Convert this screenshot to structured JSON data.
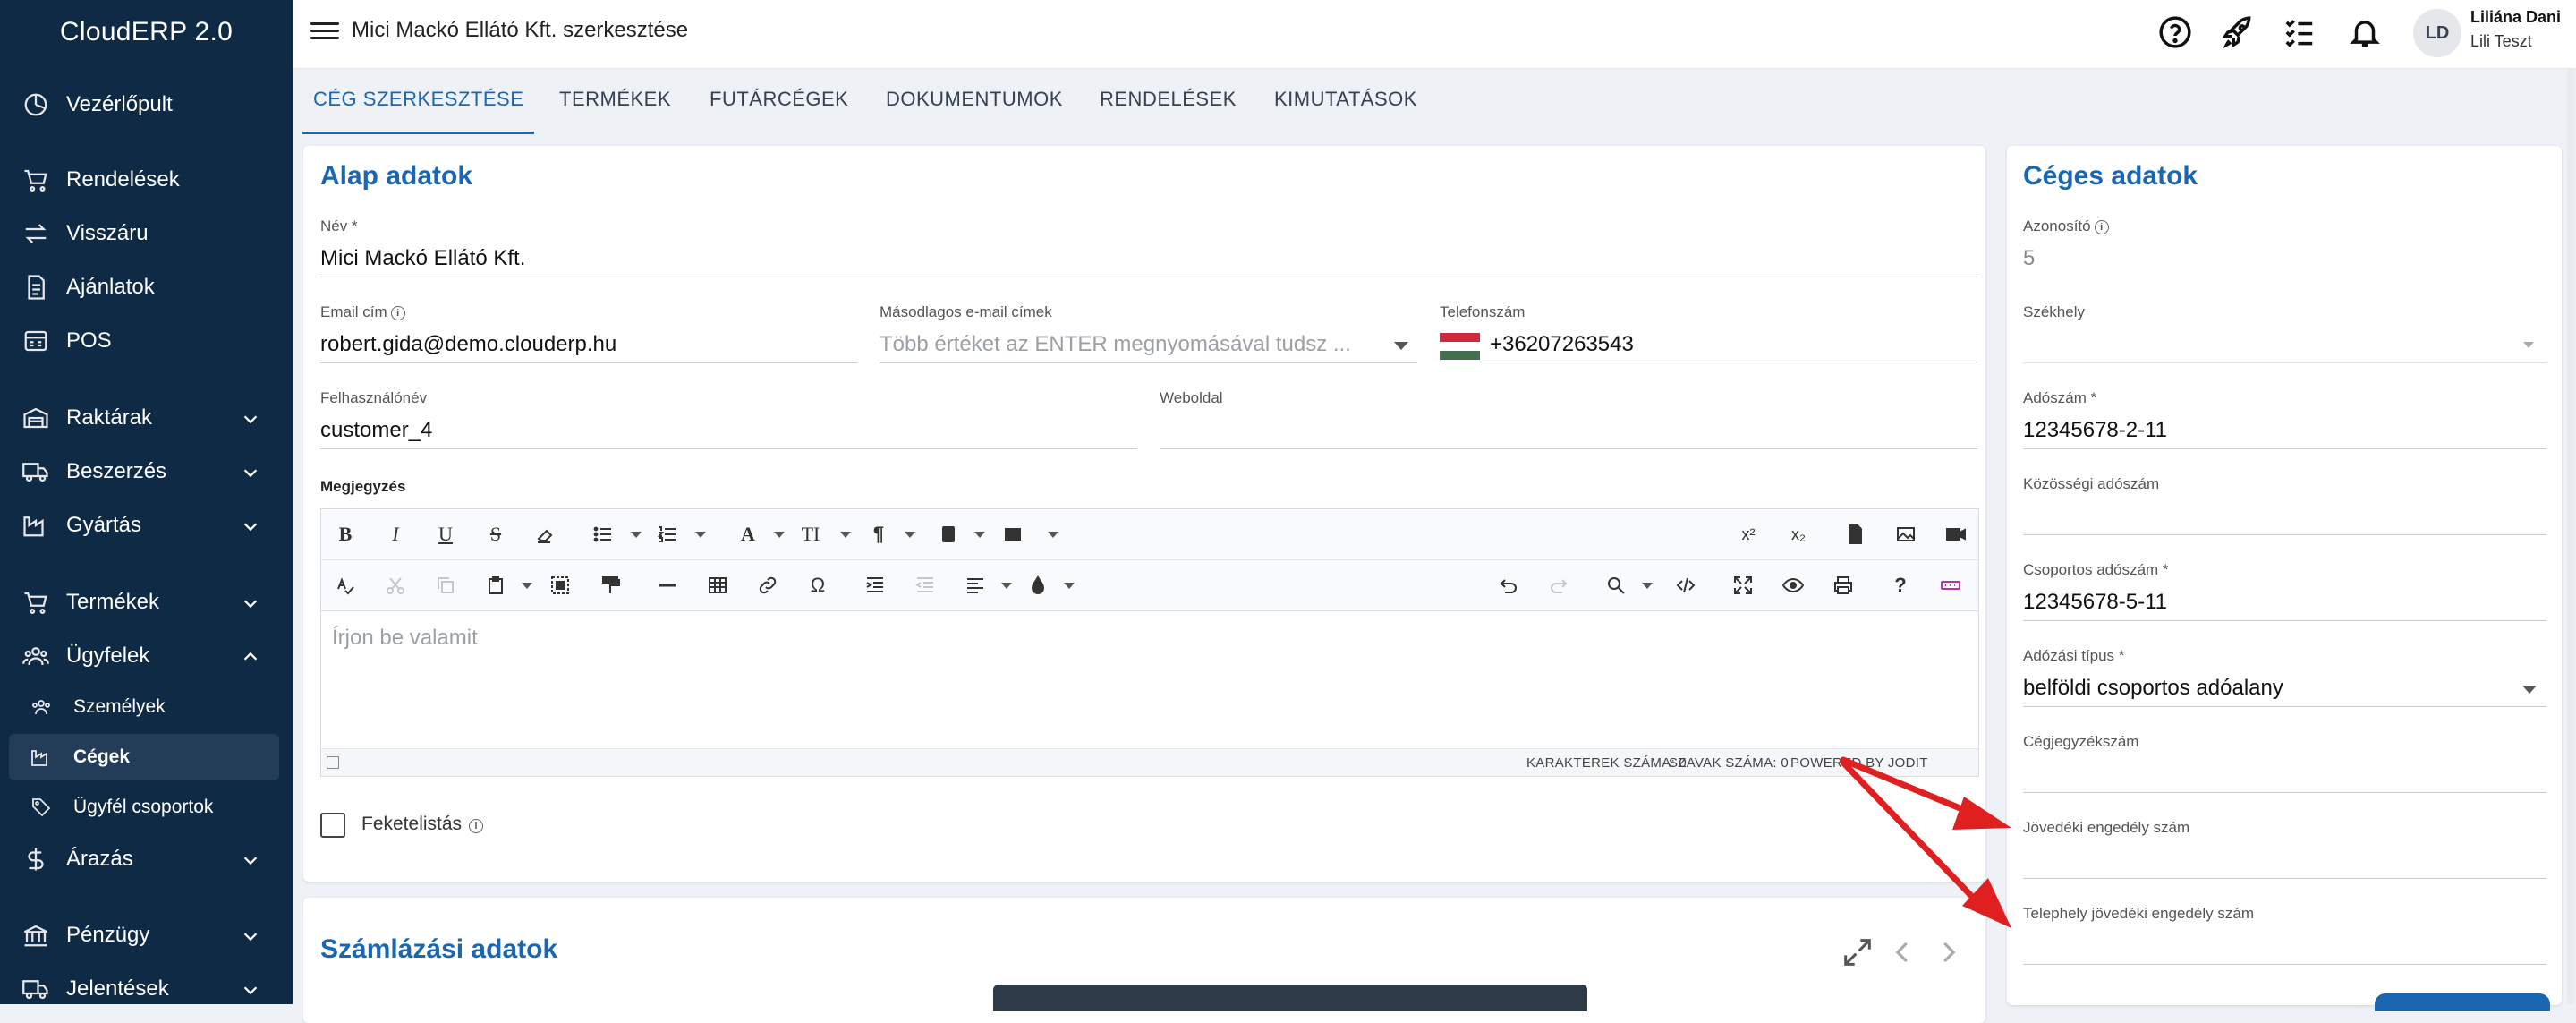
{
  "app": {
    "name": "CloudERP 2.0"
  },
  "sidebar": {
    "items": [
      {
        "label": "Vezérlőpult",
        "icon": "dashboard-gauge-icon"
      },
      {
        "label": "Rendelések",
        "icon": "cart-icon"
      },
      {
        "label": "Visszáru",
        "icon": "swap-arrows-icon"
      },
      {
        "label": "Ajánlatok",
        "icon": "document-icon"
      },
      {
        "label": "POS",
        "icon": "pos-register-icon"
      },
      {
        "label": "Raktárak",
        "icon": "warehouse-icon",
        "expandable": true
      },
      {
        "label": "Beszerzés",
        "icon": "truck-icon",
        "expandable": true
      },
      {
        "label": "Gyártás",
        "icon": "factory-icon",
        "expandable": true
      },
      {
        "label": "Termékek",
        "icon": "cart-icon",
        "expandable": true
      },
      {
        "label": "Ügyfelek",
        "icon": "users-icon",
        "expandable": true,
        "expanded": true
      },
      {
        "label": "Árazás",
        "icon": "dollar-icon",
        "expandable": true
      },
      {
        "label": "Pénzügy",
        "icon": "bank-icon",
        "expandable": true
      },
      {
        "label": "Jelentések",
        "icon": "truck-icon",
        "expandable": true
      }
    ],
    "subitems": [
      {
        "label": "Személyek",
        "icon": "people-icon"
      },
      {
        "label": "Cégek",
        "icon": "factory-icon",
        "active": true
      },
      {
        "label": "Ügyfél csoportok",
        "icon": "tag-icon"
      }
    ]
  },
  "topbar": {
    "title": "Mici Mackó Ellátó Kft. szerkesztése",
    "icons": [
      "help-icon",
      "rocket-icon",
      "checklist-icon",
      "bell-icon"
    ],
    "user": {
      "initials": "LD",
      "name": "Liliána Dani",
      "subtitle": "Lili Teszt"
    }
  },
  "tabs": [
    {
      "label": "CÉG SZERKESZTÉSE",
      "active": true
    },
    {
      "label": "TERMÉKEK"
    },
    {
      "label": "FUTÁRCÉGEK"
    },
    {
      "label": "DOKUMENTUMOK"
    },
    {
      "label": "RENDELÉSEK"
    },
    {
      "label": "KIMUTATÁSOK"
    }
  ],
  "basic": {
    "title": "Alap adatok",
    "name": {
      "label": "Név *",
      "value": "Mici Mackó Ellátó Kft."
    },
    "email": {
      "label": "Email cím",
      "value": "robert.gida@demo.clouderp.hu"
    },
    "secondary_email": {
      "label": "Másodlagos e-mail címek",
      "placeholder": "Több értéket az ENTER megnyomásával tudsz ..."
    },
    "phone": {
      "label": "Telefonszám",
      "value": "+36207263543",
      "flag": "hungary-flag"
    },
    "username": {
      "label": "Felhasználónév",
      "value": "customer_4"
    },
    "website": {
      "label": "Weboldal",
      "value": ""
    },
    "note": {
      "label": "Megjegyzés",
      "placeholder": "Írjon be valamit",
      "status": {
        "chars": "KARAKTEREK SZÁMA: 0",
        "words": "SZAVAK SZÁMA: 0",
        "powered": "POWERED BY JODIT"
      }
    },
    "blacklist": {
      "label": "Feketelistás",
      "checked": false
    }
  },
  "billing": {
    "title": "Számlázási adatok"
  },
  "company": {
    "title": "Céges adatok",
    "id": {
      "label": "Azonosító",
      "value": "5"
    },
    "seat": {
      "label": "Székhely",
      "value": ""
    },
    "tax_number": {
      "label": "Adószám *",
      "value": "12345678-2-11"
    },
    "eu_tax": {
      "label": "Közösségi adószám",
      "value": ""
    },
    "group_tax": {
      "label": "Csoportos adószám *",
      "value": "12345678-5-11"
    },
    "tax_type": {
      "label": "Adózási típus *",
      "value": "belföldi csoportos adóalany"
    },
    "reg_number": {
      "label": "Cégjegyzékszám",
      "value": ""
    },
    "excise": {
      "label": "Jövedéki engedély szám",
      "value": ""
    },
    "site_excise": {
      "label": "Telephely jövedéki engedély szám",
      "value": ""
    }
  },
  "colors": {
    "sidebar": "#0f2a45",
    "accent": "#1b66b1",
    "annotation_arrow": "#e02020"
  }
}
